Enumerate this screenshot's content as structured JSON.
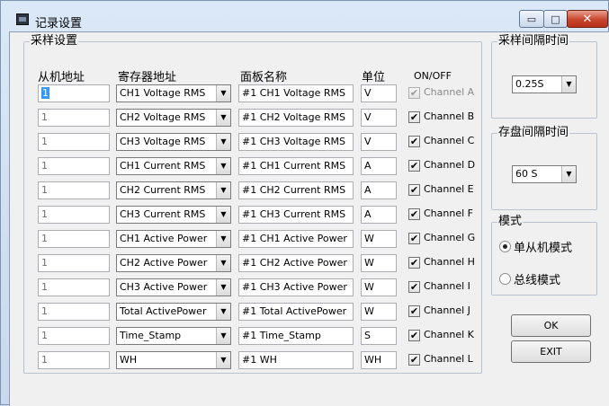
{
  "window": {
    "title": "记录设置",
    "icon": "app-window-icon",
    "controls": {
      "minimize": "▭",
      "maximize": "□",
      "close": "✕"
    }
  },
  "sampling_group": {
    "label": "采样设置",
    "headers": {
      "slave_address": "从机地址",
      "register_address": "寄存器地址",
      "panel_name": "面板名称",
      "unit": "单位",
      "on_off": "ON/OFF"
    },
    "rows": [
      {
        "slave": "1",
        "register": "CH1 Voltage RMS",
        "panel": "#1 CH1 Voltage RMS",
        "unit": "V",
        "checked": true,
        "enabled": false,
        "channel": "Channel A"
      },
      {
        "slave": "1",
        "register": "CH2 Voltage RMS",
        "panel": "#1 CH2 Voltage RMS",
        "unit": "V",
        "checked": true,
        "enabled": true,
        "channel": "Channel B"
      },
      {
        "slave": "1",
        "register": "CH3 Voltage RMS",
        "panel": "#1 CH3 Voltage RMS",
        "unit": "V",
        "checked": true,
        "enabled": true,
        "channel": "Channel C"
      },
      {
        "slave": "1",
        "register": "CH1 Current RMS",
        "panel": "#1 CH1 Current RMS",
        "unit": "A",
        "checked": true,
        "enabled": true,
        "channel": "Channel D"
      },
      {
        "slave": "1",
        "register": "CH2 Current RMS",
        "panel": "#1 CH2 Current RMS",
        "unit": "A",
        "checked": true,
        "enabled": true,
        "channel": "Channel E"
      },
      {
        "slave": "1",
        "register": "CH3 Current RMS",
        "panel": "#1 CH3 Current RMS",
        "unit": "A",
        "checked": true,
        "enabled": true,
        "channel": "Channel F"
      },
      {
        "slave": "1",
        "register": "CH1 Active Power",
        "panel": "#1 CH1 Active Power",
        "unit": "W",
        "checked": true,
        "enabled": true,
        "channel": "Channel G"
      },
      {
        "slave": "1",
        "register": "CH2 Active Power",
        "panel": "#1 CH2 Active Power",
        "unit": "W",
        "checked": true,
        "enabled": true,
        "channel": "Channel H"
      },
      {
        "slave": "1",
        "register": "CH3 Active Power",
        "panel": "#1 CH3 Active Power",
        "unit": "W",
        "checked": true,
        "enabled": true,
        "channel": "Channel I"
      },
      {
        "slave": "1",
        "register": "Total ActivePower",
        "panel": "#1 Total ActivePower",
        "unit": "W",
        "checked": true,
        "enabled": true,
        "channel": "Channel J"
      },
      {
        "slave": "1",
        "register": "Time_Stamp",
        "panel": "#1 Time_Stamp",
        "unit": "S",
        "checked": true,
        "enabled": true,
        "channel": "Channel K"
      },
      {
        "slave": "1",
        "register": "WH",
        "panel": "#1 WH",
        "unit": "WH",
        "checked": true,
        "enabled": true,
        "channel": "Channel L"
      }
    ]
  },
  "sample_interval": {
    "label": "采样间隔时间",
    "value": "0.25S"
  },
  "save_interval": {
    "label": "存盘间隔时间",
    "value": "60 S"
  },
  "mode": {
    "label": "模式",
    "options": [
      {
        "label": "单从机模式",
        "selected": true
      },
      {
        "label": "总线模式",
        "selected": false
      }
    ]
  },
  "buttons": {
    "ok": "OK",
    "exit": "EXIT"
  },
  "glyphs": {
    "check": "✔",
    "arrow": "▼"
  }
}
